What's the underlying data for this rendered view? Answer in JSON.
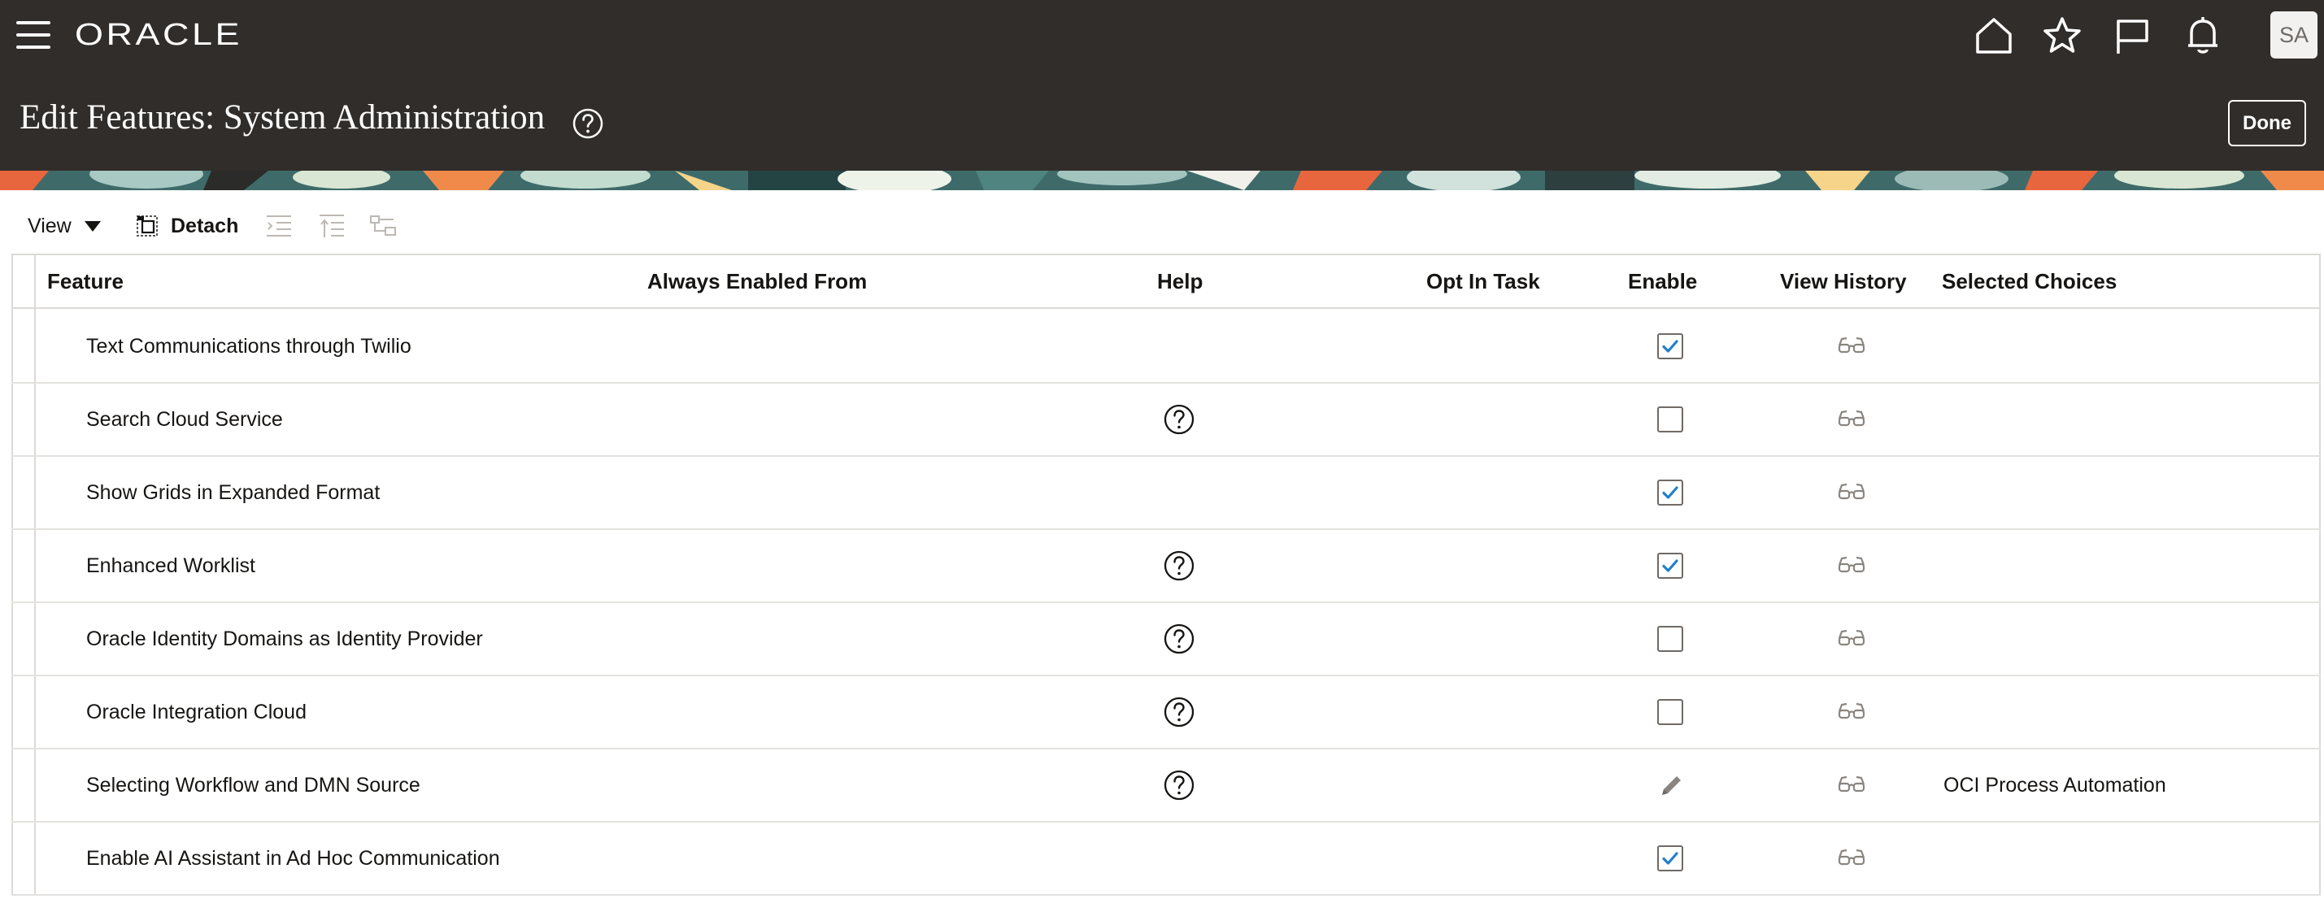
{
  "app": {
    "brand": "ORACLE",
    "avatar_initials": "SA"
  },
  "nav_icons": [
    "home-icon",
    "favorites-star-icon",
    "watchlist-flag-icon",
    "notifications-bell-icon"
  ],
  "page": {
    "title": "Edit Features: System Administration",
    "done_label": "Done"
  },
  "toolbar": {
    "view_label": "View",
    "detach_label": "Detach"
  },
  "table": {
    "columns": {
      "feature": "Feature",
      "always_enabled_from": "Always Enabled From",
      "help": "Help",
      "opt_in_task": "Opt In Task",
      "enable": "Enable",
      "view_history": "View History",
      "selected_choices": "Selected Choices"
    },
    "rows": [
      {
        "feature": "Text Communications through Twilio",
        "help": false,
        "enable": "checked",
        "selected_choices": ""
      },
      {
        "feature": "Search Cloud Service",
        "help": true,
        "enable": "unchecked",
        "selected_choices": ""
      },
      {
        "feature": "Show Grids in Expanded Format",
        "help": false,
        "enable": "checked",
        "selected_choices": ""
      },
      {
        "feature": "Enhanced Worklist",
        "help": true,
        "enable": "checked",
        "selected_choices": ""
      },
      {
        "feature": "Oracle Identity Domains as Identity Provider",
        "help": true,
        "enable": "unchecked",
        "selected_choices": ""
      },
      {
        "feature": "Oracle Integration Cloud",
        "help": true,
        "enable": "unchecked",
        "selected_choices": ""
      },
      {
        "feature": "Selecting Workflow and DMN Source",
        "help": true,
        "enable": "edit",
        "selected_choices": "OCI Process Automation"
      },
      {
        "feature": "Enable AI Assistant in Ad Hoc Communication",
        "help": false,
        "enable": "checked",
        "selected_choices": ""
      }
    ]
  },
  "colors": {
    "header_bg": "#312d2a",
    "checkbox_check": "#227ecd",
    "text": "#161513",
    "muted_icon": "#8a8580"
  }
}
